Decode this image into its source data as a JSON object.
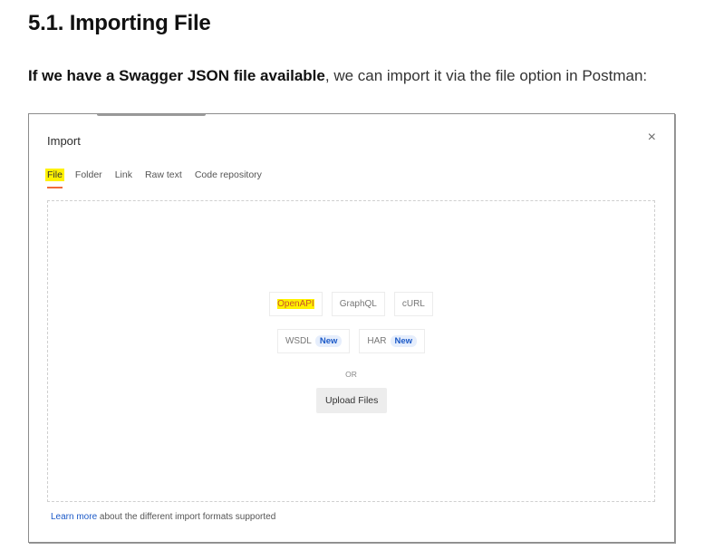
{
  "heading": "5.1. Importing File",
  "intro": {
    "bold": "If we have a Swagger JSON file available",
    "rest": ", we can import it via the file option in Postman:"
  },
  "dialog": {
    "title": "Import",
    "close_icon": "×",
    "tabs": [
      {
        "label": "File",
        "active": true
      },
      {
        "label": "Folder"
      },
      {
        "label": "Link"
      },
      {
        "label": "Raw text"
      },
      {
        "label": "Code repository"
      }
    ],
    "formats_row1": [
      "OpenAPI",
      "GraphQL",
      "cURL"
    ],
    "formats_row2": [
      {
        "label": "WSDL",
        "badge": "New"
      },
      {
        "label": "HAR",
        "badge": "New"
      }
    ],
    "or_text": "OR",
    "upload_label": "Upload Files",
    "learn_more_link": "Learn more",
    "learn_more_rest": " about the different import formats supported"
  },
  "colors": {
    "highlight": "#fff200",
    "active_tab_underline": "#f26b3a",
    "badge_text": "#1c5ac8",
    "badge_bg": "#e6eefc",
    "link": "#1c5ac8"
  }
}
